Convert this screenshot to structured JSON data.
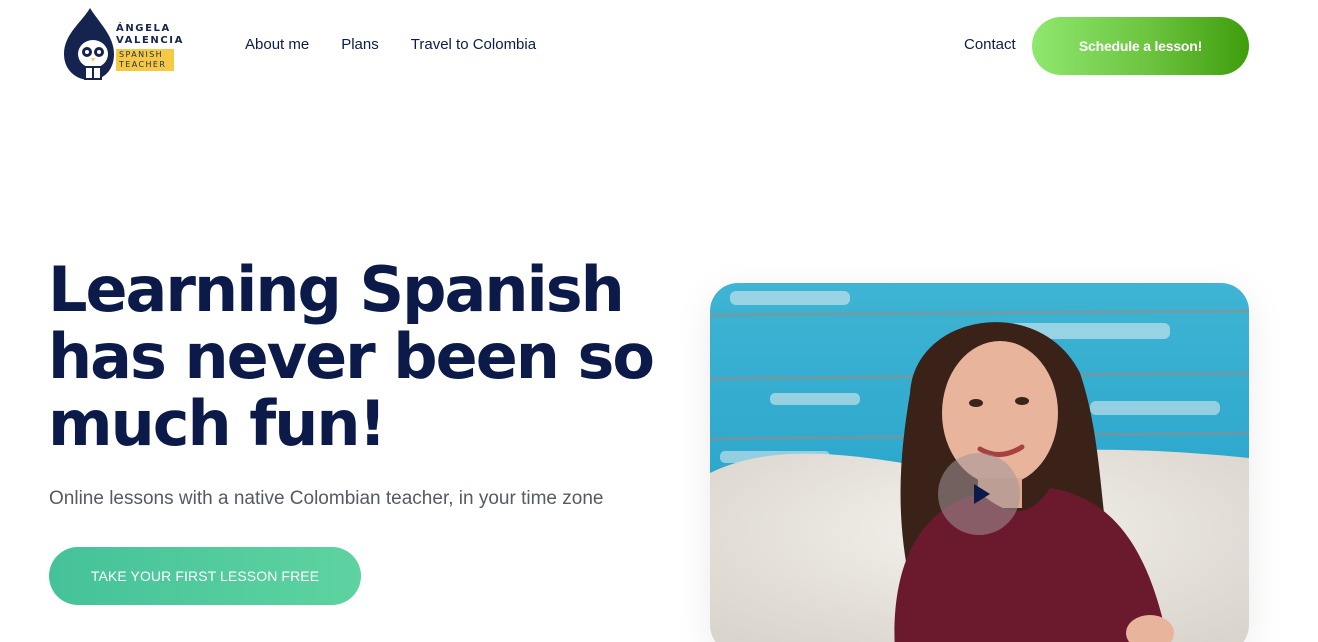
{
  "brand": {
    "name_line1": "ÁNGELA",
    "name_line2": "VALENCIA",
    "badge_line1": "SPANISH",
    "badge_line2": "TEACHER",
    "accent_color": "#f5c944",
    "primary_color": "#0b1a49"
  },
  "nav": {
    "items": [
      {
        "label": "About me"
      },
      {
        "label": "Plans"
      },
      {
        "label": "Travel to Colombia"
      }
    ],
    "contact_label": "Contact",
    "cta_label": "Schedule a lesson!",
    "cta_color": "#6bc33e"
  },
  "hero": {
    "title": "Learning Spanish has never been so much fun!",
    "subtitle": "Online lessons with a native Colombian teacher, in your time zone",
    "cta_label": "TAKE YOUR FIRST LESSON FREE",
    "cta_color": "#4fca9b"
  },
  "video": {
    "play_icon": "play-icon"
  }
}
